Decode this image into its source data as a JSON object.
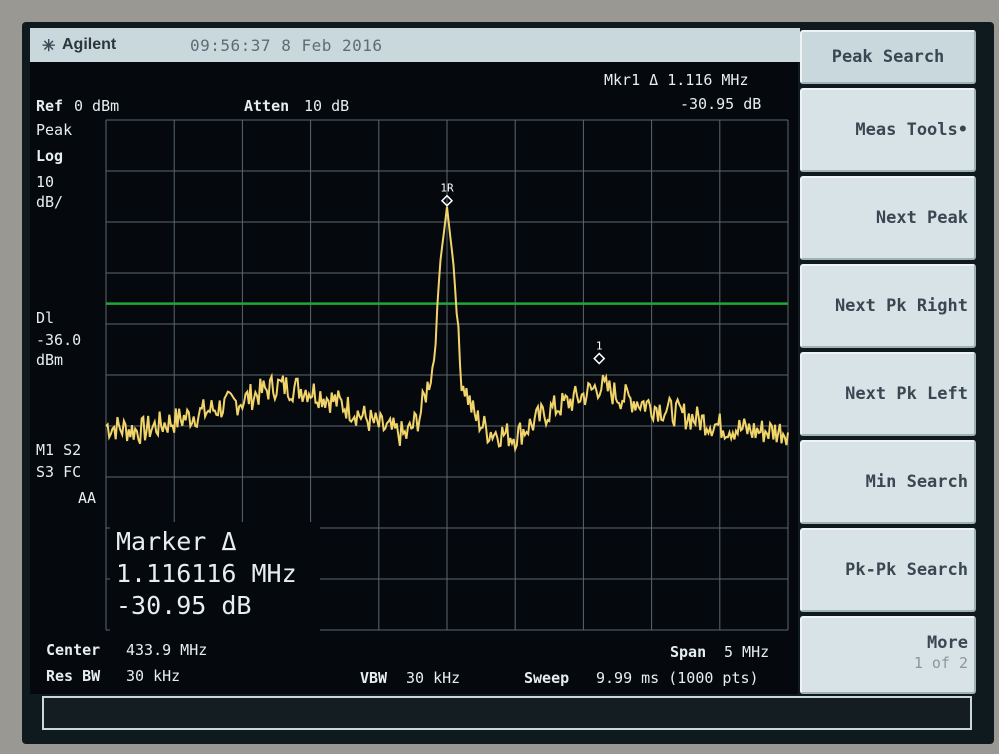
{
  "header": {
    "brand": "Agilent",
    "timestamp": "09:56:37  8 Feb 2016"
  },
  "marker_readout": {
    "line1": "Mkr1 Δ 1.116 MHz",
    "line2": "-30.95 dB"
  },
  "settings": {
    "ref_label": "Ref",
    "ref_value": "0 dBm",
    "atten_label": "Atten",
    "atten_value": "10 dB",
    "detector": "Peak",
    "scale_type": "Log",
    "scale_value": "10",
    "scale_unit": "dB/",
    "display_line_label": "Dl",
    "display_line_value": "-36.0",
    "display_line_unit": "dBm",
    "flags_line1": "M1  S2",
    "flags_line2": "S3  FC",
    "flags_line3": "AA"
  },
  "marker_box": {
    "title": "Marker Δ",
    "freq": "1.116116 MHz",
    "amp": "-30.95 dB"
  },
  "trace_markers": {
    "ref_marker_label": "1R",
    "delta_marker_label": "1"
  },
  "footer": {
    "center_label": "Center",
    "center_value": "433.9 MHz",
    "span_label": "Span",
    "span_value": "5 MHz",
    "resbw_label": "Res BW",
    "resbw_value": "30 kHz",
    "vbw_label": "VBW",
    "vbw_value": "30 kHz",
    "sweep_label": "Sweep",
    "sweep_value": "9.99 ms (1000 pts)"
  },
  "softkeys": {
    "title": "Peak Search",
    "items": [
      {
        "label": "Meas Tools•"
      },
      {
        "label": "Next Peak"
      },
      {
        "label": "Next Pk Right"
      },
      {
        "label": "Next Pk Left"
      },
      {
        "label": "Min Search"
      },
      {
        "label": "Pk-Pk Search"
      },
      {
        "label": "More",
        "sub": "1 of 2"
      }
    ]
  },
  "colors": {
    "trace": "#f2d56a",
    "display_line": "#1fa83a",
    "grid": "#5a6770",
    "background": "#05090d"
  },
  "chart_data": {
    "type": "line",
    "center_frequency": "433.9 MHz",
    "span": "5 MHz",
    "reference_level_dbm": 0,
    "scale_db_per_div": 10,
    "display_line_dbm": -36.0,
    "x_range_mhz": [
      431.4,
      436.4
    ],
    "y_range_dbm": [
      -100,
      0
    ],
    "grid": true,
    "series": [
      {
        "x": [
          431.4,
          431.65,
          431.9,
          432.15,
          432.4,
          432.65,
          432.9,
          433.15,
          433.4,
          433.6,
          433.7,
          433.8,
          433.85,
          433.9,
          433.95,
          434.0,
          434.1,
          434.2,
          434.4,
          434.65,
          434.9,
          435.02,
          435.15,
          435.4,
          435.65,
          435.9,
          436.15,
          436.4
        ],
        "y": [
          -60,
          -61,
          -59,
          -57,
          -55,
          -52,
          -53,
          -56,
          -60,
          -62,
          -58,
          -48,
          -28,
          -17,
          -29,
          -50,
          -58,
          -61,
          -62,
          -57,
          -54,
          -52,
          -54,
          -56,
          -58,
          -60,
          -61,
          -61
        ]
      }
    ],
    "markers": [
      {
        "label": "1R",
        "x": 433.9,
        "y": -17.0
      },
      {
        "label": "1",
        "x": 435.016,
        "y": -47.95
      }
    ]
  }
}
